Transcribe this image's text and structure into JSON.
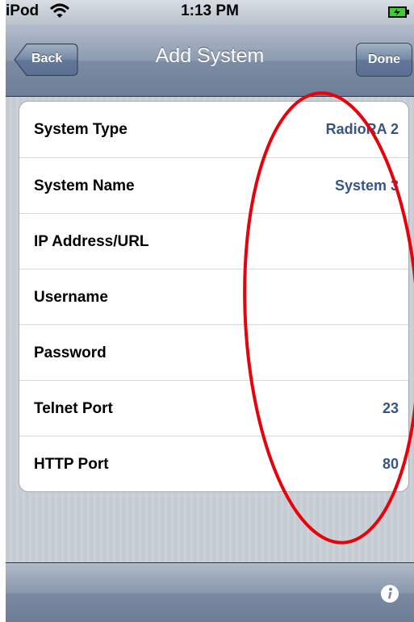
{
  "status_bar": {
    "carrier": "iPod",
    "time": "1:13 PM"
  },
  "nav": {
    "title": "Add System",
    "back_label": "Back",
    "done_label": "Done"
  },
  "rows": [
    {
      "label": "System Type",
      "value": "RadioRA 2"
    },
    {
      "label": "System Name",
      "value": "System 3"
    },
    {
      "label": "IP Address/URL",
      "value": ""
    },
    {
      "label": "Username",
      "value": ""
    },
    {
      "label": "Password",
      "value": ""
    },
    {
      "label": "Telnet Port",
      "value": "23"
    },
    {
      "label": "HTTP Port",
      "value": "80"
    }
  ],
  "toolbar": {
    "info_icon": "info-icon"
  },
  "colors": {
    "value_text": "#385487",
    "annotation": "#e8000b"
  }
}
